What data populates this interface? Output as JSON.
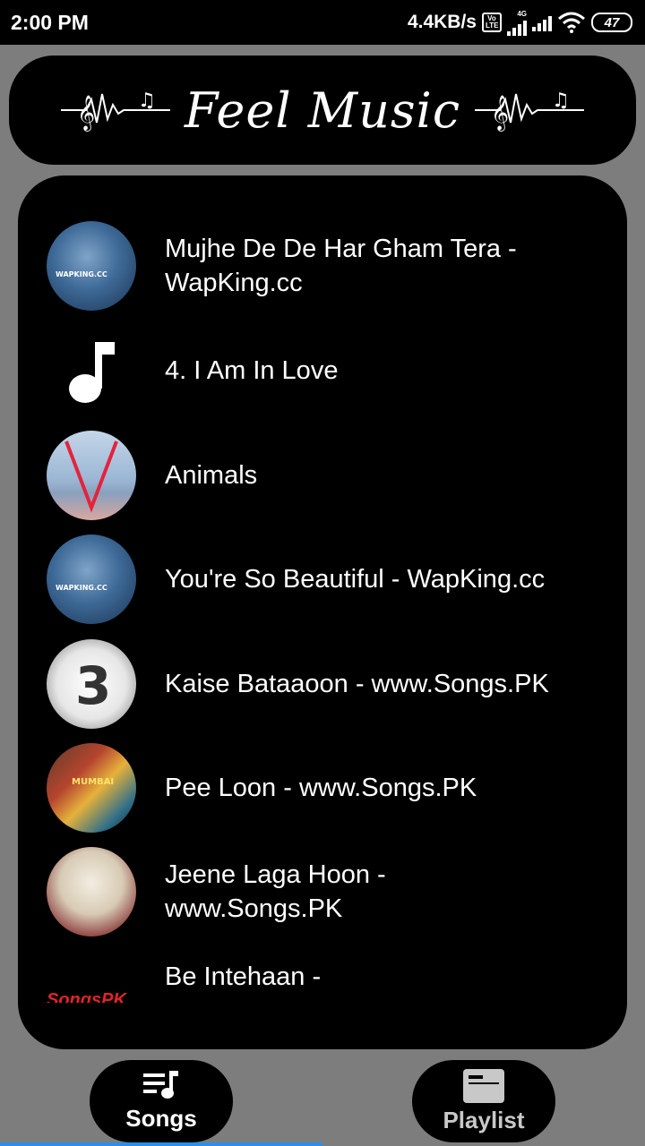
{
  "status_bar": {
    "time": "2:00 PM",
    "speed": "4.4KB/s",
    "network": "4G",
    "battery": "47"
  },
  "header": {
    "title": "Feel Music",
    "icon": "music-pulse-icon"
  },
  "songs": [
    {
      "title": "Mujhe De De Har Gham Tera - WapKing.cc",
      "art": "album-art-blue",
      "art_text": "WAPKING.CC"
    },
    {
      "title": "4. I Am In Love",
      "art": "music-note-icon",
      "art_text": ""
    },
    {
      "title": "Animals",
      "art": "album-art-v",
      "art_text": ""
    },
    {
      "title": "You're So Beautiful - WapKing.cc",
      "art": "album-art-blue",
      "art_text": "WAPKING.CC"
    },
    {
      "title": "Kaise Bataaoon - www.Songs.PK",
      "art": "album-art-3",
      "art_text": "3"
    },
    {
      "title": "Pee Loon - www.Songs.PK",
      "art": "album-art-mumbai",
      "art_text": "MUMBAI"
    },
    {
      "title": "Jeene Laga Hoon - www.Songs.PK",
      "art": "album-art-ramaiya",
      "art_text": ""
    },
    {
      "title": "Be Intehaan -",
      "art": "songs-pk-logo",
      "art_text": "SongsPK"
    }
  ],
  "nav": {
    "songs_label": "Songs",
    "playlist_label": "Playlist",
    "active": "Songs"
  },
  "colors": {
    "background": "#7d7d7d",
    "card": "#000000",
    "indicator": "#2e8de8"
  }
}
